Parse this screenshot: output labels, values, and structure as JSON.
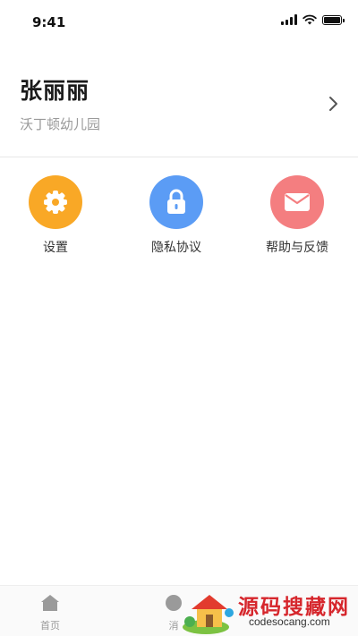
{
  "status_bar": {
    "time": "9:41",
    "icons": [
      "signal-icon",
      "wifi-icon",
      "battery-icon"
    ]
  },
  "profile": {
    "name": "张丽丽",
    "organization": "沃丁顿幼儿园",
    "chevron_icon": "chevron-right-icon"
  },
  "menu": {
    "items": [
      {
        "label": "设置",
        "icon": "gear-icon",
        "color": "#F9A826"
      },
      {
        "label": "隐私协议",
        "icon": "lock-icon",
        "color": "#5B9CF5"
      },
      {
        "label": "帮助与反馈",
        "icon": "envelope-icon",
        "color": "#F47E80"
      }
    ]
  },
  "tab_bar": {
    "tabs": [
      {
        "label": "首页",
        "icon": "home-icon"
      },
      {
        "label": "消",
        "icon": "message-icon"
      }
    ]
  },
  "watermark": {
    "title": "源码搜藏网",
    "url": "codesocang.com"
  },
  "colors": {
    "text_primary": "#1A1A1A",
    "text_secondary": "#9A9A9A",
    "divider": "#E8E8E8"
  }
}
